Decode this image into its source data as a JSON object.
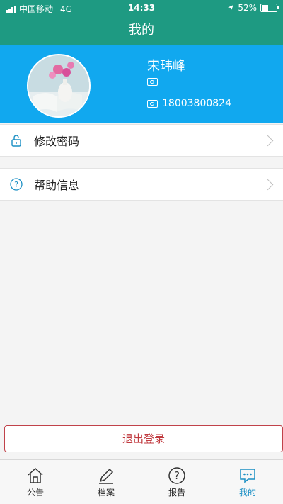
{
  "status": {
    "carrier": "中国移动",
    "network": "4G",
    "time": "14:33",
    "battery": "52%",
    "battery_level": 0.52
  },
  "header": {
    "title": "我的"
  },
  "profile": {
    "name": "宋玮峰",
    "line1": "",
    "phone": "18003800824"
  },
  "menu": [
    {
      "label": "修改密码",
      "icon": "unlock-icon"
    },
    {
      "label": "帮助信息",
      "icon": "help-circle-icon"
    }
  ],
  "logout_label": "退出登录",
  "tabs": [
    {
      "label": "公告",
      "icon": "home-icon"
    },
    {
      "label": "档案",
      "icon": "pencil-icon"
    },
    {
      "label": "报告",
      "icon": "help-circle-icon"
    },
    {
      "label": "我的",
      "icon": "chat-bubble-icon",
      "active": true
    }
  ],
  "colors": {
    "header": "#1e9a82",
    "profile": "#11a8ef",
    "accent": "#1a8fc4",
    "logout": "#c0424a"
  }
}
